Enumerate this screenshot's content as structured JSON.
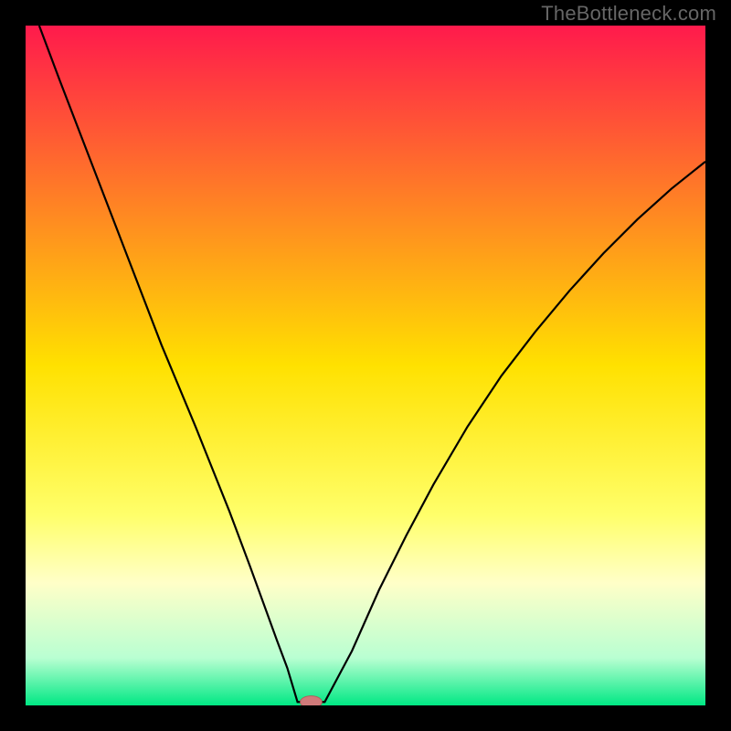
{
  "watermark_text": "TheBottleneck.com",
  "chart_data": {
    "type": "line",
    "title": "",
    "xlabel": "",
    "ylabel": "",
    "xlim": [
      0,
      100
    ],
    "ylim": [
      0,
      100
    ],
    "axes_visible": false,
    "background_gradient": {
      "stops": [
        {
          "offset": 0.0,
          "color": "#ff1a4c"
        },
        {
          "offset": 0.5,
          "color": "#ffe100"
        },
        {
          "offset": 0.72,
          "color": "#ffff6a"
        },
        {
          "offset": 0.82,
          "color": "#ffffc8"
        },
        {
          "offset": 0.93,
          "color": "#b9ffd2"
        },
        {
          "offset": 1.0,
          "color": "#00e884"
        }
      ]
    },
    "series": [
      {
        "name": "bottleneck-curve",
        "color": "#000000",
        "width": 2.2,
        "x": [
          2,
          5,
          10,
          15,
          20,
          25,
          30,
          33,
          35,
          37,
          38.5,
          40,
          44,
          48,
          52,
          56,
          60,
          65,
          70,
          75,
          80,
          85,
          90,
          95,
          100
        ],
        "values": [
          100,
          92,
          79,
          66,
          53,
          41,
          28.5,
          20.5,
          15,
          9.5,
          5.5,
          0.5,
          0.5,
          8,
          17,
          25,
          32.5,
          41,
          48.5,
          55,
          61,
          66.5,
          71.5,
          76,
          80
        ]
      }
    ],
    "markers": [
      {
        "name": "optimum-marker",
        "x": 42,
        "y": 0.5,
        "rx": 1.6,
        "ry": 0.9,
        "color_fill": "#d07a7a",
        "color_stroke": "#b35a5a"
      }
    ]
  }
}
